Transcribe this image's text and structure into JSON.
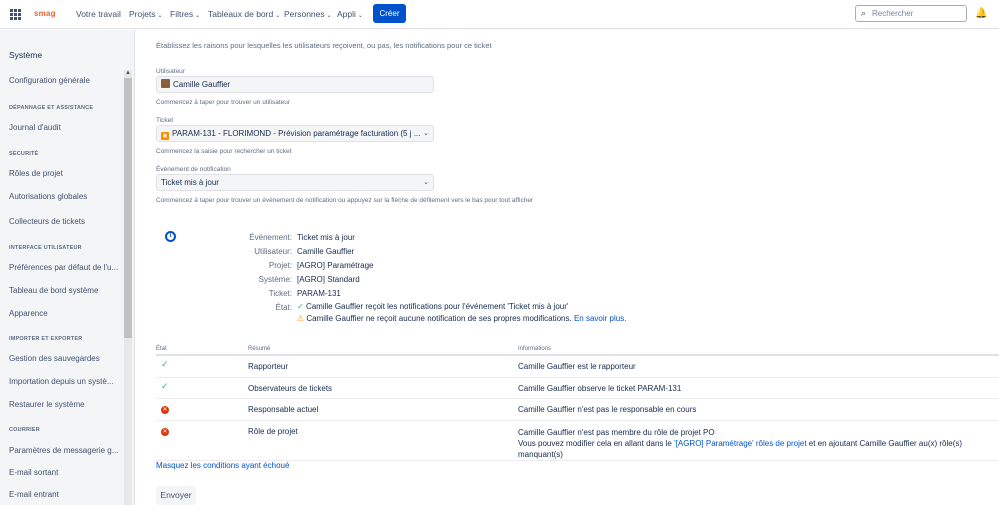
{
  "topnav": {
    "logo": "smag",
    "items": [
      "Votre travail",
      "Projets",
      "Filtres",
      "Tableaux de bord",
      "Personnes",
      "Appli"
    ],
    "create_label": "Créer",
    "search_placeholder": "Rechercher"
  },
  "sidebar": {
    "title": "Système",
    "config": "Configuration générale",
    "sections": {
      "depannage": "DÉPANNAGE ET ASSISTANCE",
      "journal": "Journal d'audit",
      "securite": "SÉCURITÉ",
      "roles": "Rôles de projet",
      "autorisations": "Autorisations globales",
      "collecteurs": "Collecteurs de tickets",
      "interface": "INTERFACE UTILISATEUR",
      "preferences": "Préférences par défaut de l'u...",
      "tableau": "Tableau de bord système",
      "apparence": "Apparence",
      "importer": "IMPORTER ET EXPORTER",
      "sauvegardes": "Gestion des sauvegardes",
      "importation": "Importation depuis un systè...",
      "restaurer": "Restaurer le système",
      "courrier": "COURRIER",
      "messagerie": "Paramètres de messagerie g...",
      "sortant": "E-mail sortant",
      "entrant": "E-mail entrant"
    }
  },
  "main": {
    "intro": "Établissez les raisons pour lesquelles les utilisateurs reçoivent, ou pas, les notifications pour ce ticket",
    "user_label": "Utilisateur",
    "user_value": "Camille Gauffier",
    "user_help": "Commencez à taper pour trouver un utilisateur",
    "ticket_label": "Ticket",
    "ticket_value": "PARAM-131 - FLORIMOND - Prévision paramétrage facturation (5 j ...",
    "ticket_help": "Commencez la saisie pour rechercher un ticket",
    "event_label": "Événement de notification",
    "event_value": "Ticket mis à jour",
    "event_help": "Commencez à taper pour trouver un événement de notification ou appuyez sur la flèche de défilement vers le bas pour tout afficher"
  },
  "summary": {
    "event_label": "Événement:",
    "event_value": "Ticket mis à jour",
    "user_label": "Utilisateur:",
    "user_value": "Camille Gauffier",
    "project_label": "Projet:",
    "project_value": "[AGRO] Paramétrage",
    "system_label": "Système:",
    "system_value": "[AGRO] Standard",
    "ticket_label": "Ticket:",
    "ticket_value": "PARAM-131",
    "state_label": "État:",
    "state_line1": "Camille Gauffier reçoit les notifications pour l'événement 'Ticket mis à jour'",
    "state_line2": "Camille Gauffier ne reçoit aucune notification de ses propres modifications.",
    "learn_more": "En savoir plus"
  },
  "table": {
    "headers": [
      "État",
      "Résumé",
      "Informations"
    ],
    "rows": [
      {
        "status": "ok",
        "summary": "Rapporteur",
        "info": "Camille Gauffier est le rapporteur"
      },
      {
        "status": "ok",
        "summary": "Observateurs de tickets",
        "info": "Camille Gauffier observe le ticket PARAM-131"
      },
      {
        "status": "error",
        "summary": "Responsable actuel",
        "info": "Camille Gauffier n'est pas le responsable en cours"
      },
      {
        "status": "error",
        "summary": "Rôle de projet",
        "info": "Camille Gauffier n'est pas membre du rôle de projet PO"
      }
    ],
    "role_note_pre": "Vous pouvez modifier cela en allant dans le ",
    "role_note_link": "'[AGRO] Paramétrage' rôles de projet",
    "role_note_post": " et en ajoutant Camille Gauffier au(x) rôle(s) manquant(s)"
  },
  "hide_failed": "Masquez les conditions ayant échoué",
  "send_label": "Envoyer"
}
